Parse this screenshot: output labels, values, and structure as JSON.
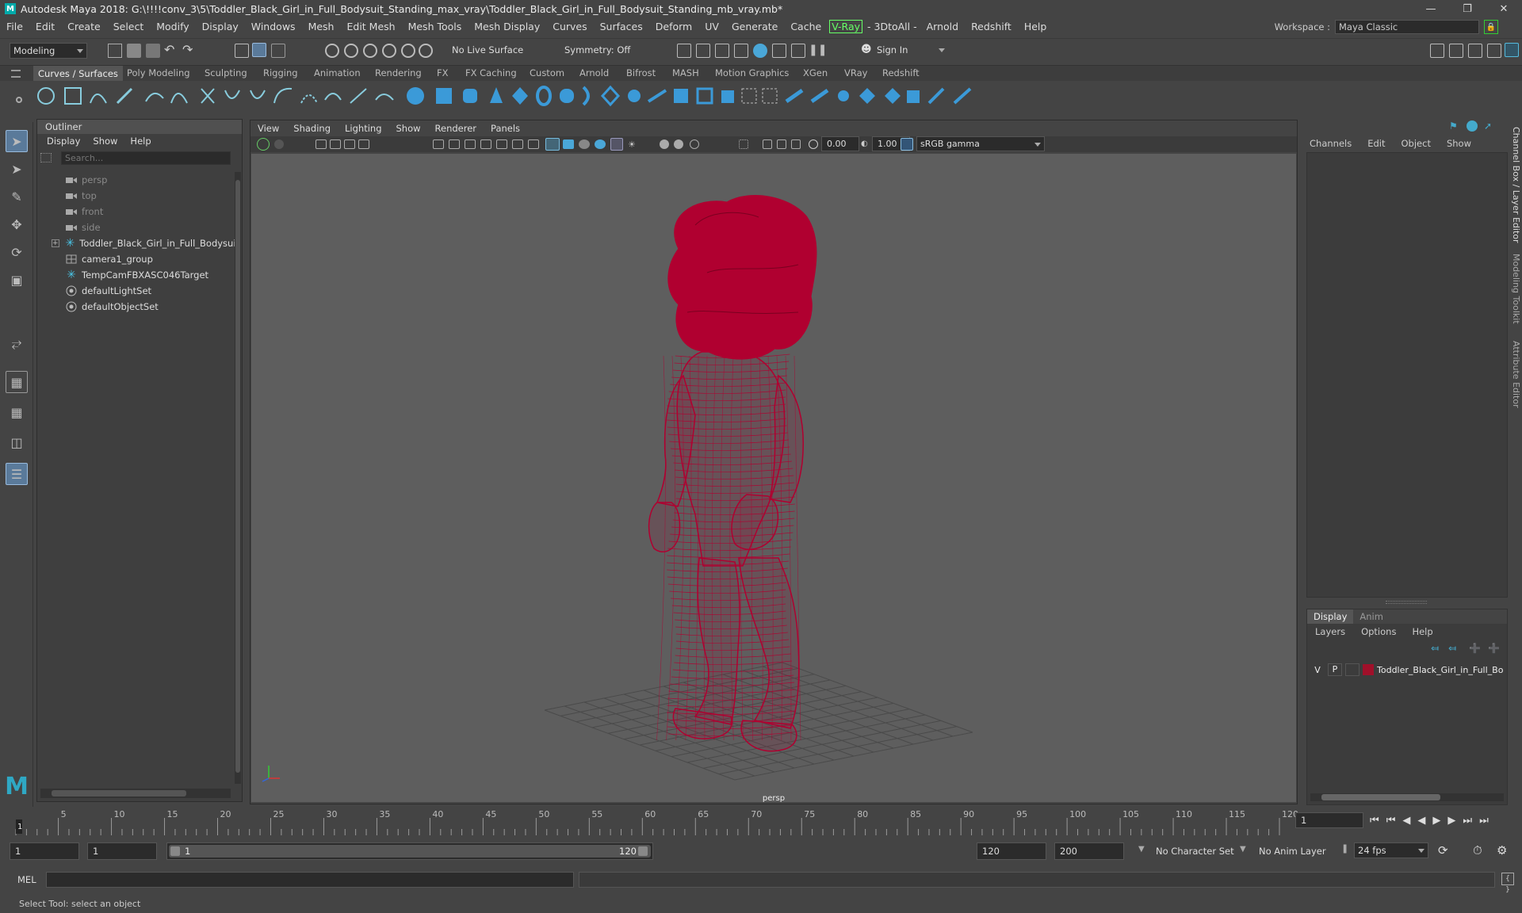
{
  "window": {
    "title": "Autodesk Maya 2018: G:\\!!!!conv_3\\5\\Toddler_Black_Girl_in_Full_Bodysuit_Standing_max_vray\\Toddler_Black_Girl_in_Full_Bodysuit_Standing_mb_vray.mb*",
    "logo": "M"
  },
  "menubar": {
    "items": [
      "File",
      "Edit",
      "Create",
      "Select",
      "Modify",
      "Display",
      "Windows",
      "Mesh",
      "Edit Mesh",
      "Mesh Tools",
      "Mesh Display",
      "Curves",
      "Surfaces",
      "Deform",
      "UV",
      "Generate",
      "Cache"
    ],
    "vray": "V-Ray",
    "items2": [
      "- 3DtoAll -",
      "Arnold",
      "Redshift",
      "Help"
    ],
    "workspace_label": "Workspace :",
    "workspace_value": "Maya Classic"
  },
  "statusline": {
    "mode": "Modeling",
    "live_surface": "No Live Surface",
    "symmetry": "Symmetry: Off",
    "sign_in": "Sign In"
  },
  "shelf": {
    "tabs": [
      "Curves / Surfaces",
      "Poly Modeling",
      "Sculpting",
      "Rigging",
      "Animation",
      "Rendering",
      "FX",
      "FX Caching",
      "Custom",
      "Arnold",
      "Bifrost",
      "MASH",
      "Motion Graphics",
      "XGen",
      "VRay",
      "Redshift"
    ],
    "active_index": 0
  },
  "outliner": {
    "title": "Outliner",
    "menus": [
      "Display",
      "Show",
      "Help"
    ],
    "search_placeholder": "Search...",
    "items": [
      {
        "label": "persp",
        "icon": "camera-icon",
        "dim": true
      },
      {
        "label": "top",
        "icon": "camera-icon",
        "dim": true
      },
      {
        "label": "front",
        "icon": "camera-icon",
        "dim": true
      },
      {
        "label": "side",
        "icon": "camera-icon",
        "dim": true
      },
      {
        "label": "Toddler_Black_Girl_in_Full_Bodysuit_S",
        "icon": "joint-icon",
        "dim": false,
        "expand": "+"
      },
      {
        "label": "camera1_group",
        "icon": "group-icon",
        "dim": false
      },
      {
        "label": "TempCamFBXASC046Target",
        "icon": "joint-icon",
        "dim": false
      },
      {
        "label": "defaultLightSet",
        "icon": "set-icon",
        "dim": false
      },
      {
        "label": "defaultObjectSet",
        "icon": "set-icon",
        "dim": false
      }
    ]
  },
  "viewport": {
    "menus": [
      "View",
      "Shading",
      "Lighting",
      "Show",
      "Renderer",
      "Panels"
    ],
    "exposure": "0.00",
    "gamma": "1.00",
    "color_space": "sRGB gamma",
    "camera_label": "persp",
    "wire_color": "#b00030"
  },
  "channelbox": {
    "menus": [
      "Channels",
      "Edit",
      "Object",
      "Show"
    ],
    "side_tabs": [
      "Channel Box / Layer Editor",
      "Modeling Toolkit",
      "Attribute Editor"
    ]
  },
  "layers": {
    "tabs": [
      "Display",
      "Anim"
    ],
    "menus": [
      "Layers",
      "Options",
      "Help"
    ],
    "layer": {
      "v": "V",
      "p": "P",
      "name": "Toddler_Black_Girl_in_Full_Boc",
      "color": "#a0102a"
    }
  },
  "timeline": {
    "ticks": [
      "5",
      "10",
      "15",
      "20",
      "25",
      "30",
      "35",
      "40",
      "45",
      "50",
      "55",
      "60",
      "65",
      "70",
      "75",
      "80",
      "85",
      "90",
      "95",
      "100",
      "105",
      "110",
      "115",
      "120"
    ],
    "current_frame_marker": "1",
    "current_frame_field": "1"
  },
  "range": {
    "start": "1",
    "playback_start": "1",
    "slider_start": "1",
    "slider_end": "120",
    "playback_end": "120",
    "end": "200",
    "character_set": "No Character Set",
    "anim_layer": "No Anim Layer",
    "fps": "24 fps"
  },
  "cmdline": {
    "label": "MEL"
  },
  "helpline": {
    "text": "Select Tool: select an object"
  }
}
